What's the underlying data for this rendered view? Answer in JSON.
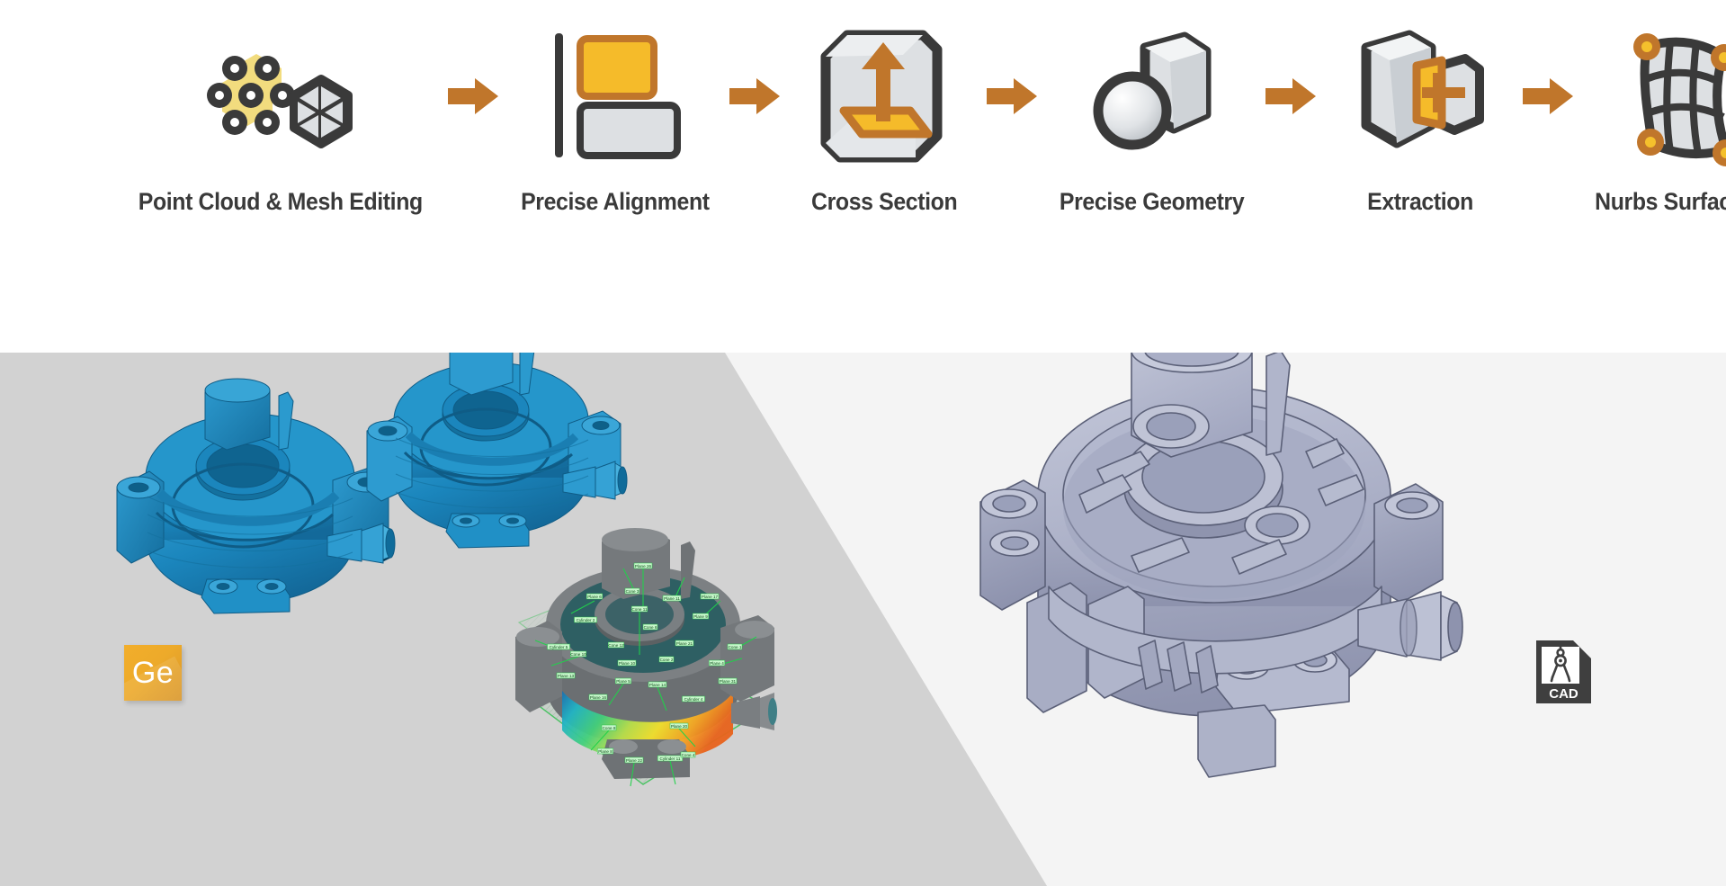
{
  "workflow": {
    "steps": [
      {
        "label": "Point Cloud & Mesh Editing",
        "icon": "point-cloud-mesh-icon"
      },
      {
        "label": "Precise Alignment",
        "icon": "precise-alignment-icon"
      },
      {
        "label": "Cross Section",
        "icon": "cross-section-icon"
      },
      {
        "label": "Precise Geometry",
        "icon": "precise-geometry-icon"
      },
      {
        "label": "Extraction",
        "icon": "extraction-icon"
      },
      {
        "label": "Nurbs Surfacing",
        "icon": "nurbs-surfacing-icon"
      }
    ],
    "arrow_icon": "right-arrow-icon"
  },
  "showcase": {
    "left_pane": {
      "background_color": "#d2d2d2",
      "badge": {
        "text": "Ge",
        "color": "#edaa2a",
        "text_color": "#ffffff"
      },
      "models": [
        {
          "name": "scanned-mesh-part-front",
          "color": "#1b86bd"
        },
        {
          "name": "scanned-mesh-part-back",
          "color": "#1b86bd"
        },
        {
          "name": "feature-inspection-model",
          "annotation_color": "#20d24a",
          "labels": [
            "Plane 6",
            "Cone 3",
            "Plane 11",
            "Plane 9",
            "Cone 10",
            "Plane 4",
            "Plane 5",
            "Plane 14",
            "Cone 8",
            "Plane 20",
            "Cone 11",
            "Plane 26",
            "Cylinder 5",
            "Cone 1",
            "Plane 22",
            "Cylinder 11",
            "Plane 13",
            "Plane 31",
            "Cone 12",
            "Plane 21",
            "Plane 16",
            "Cylinder 4",
            "Cylinder 2",
            "Plane 17",
            "Cone 6",
            "Plane 10",
            "Cone 2",
            "Plane 8",
            "Cone 4"
          ],
          "deviation_colors": [
            "#1b6fb0",
            "#21b5c4",
            "#43d07a",
            "#b9e04a",
            "#f2e12c",
            "#f5a623",
            "#e8631c"
          ]
        }
      ]
    },
    "right_pane": {
      "background_color": "#f4f4f4",
      "badge": {
        "text": "CAD",
        "icon": "cad-file-icon",
        "color": "#3f3f3f"
      },
      "models": [
        {
          "name": "cad-solid-part",
          "color": "#a9aec6"
        }
      ]
    }
  },
  "colors": {
    "arrow": "#c0762b",
    "icon_outline": "#3a3a3a",
    "icon_fill_light": "#dcdfe2",
    "icon_accent_yellow": "#f5c02c",
    "icon_accent_orange": "#c0762b",
    "label_text": "#3a3a3a",
    "scan_blue": "#1b86bd",
    "cad_lavender": "#a9aec6"
  }
}
